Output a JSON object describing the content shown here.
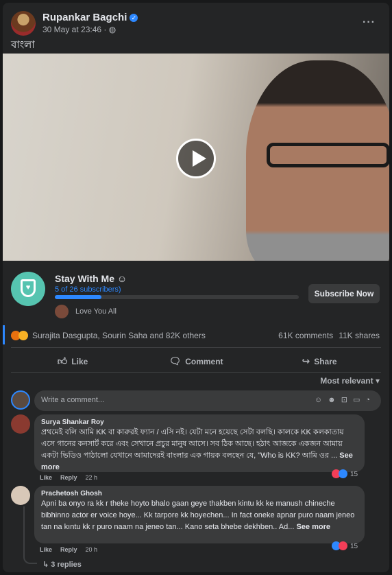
{
  "post": {
    "author": "Rupankar Bagchi",
    "timestamp": "30 May at 23:46 ·",
    "privacy_icon": "globe-icon",
    "caption": "বাংলা"
  },
  "subscription": {
    "title": "Stay With Me ☺",
    "subscribers": "5 of 26 subscribers)",
    "progress": 0.19,
    "fan_text": "Love You All",
    "button": "Subscribe Now"
  },
  "reactions": {
    "names": "Surajita Dasgupta, Sourin Saha and 82K others",
    "comments": "61K comments",
    "shares": "11K shares"
  },
  "actions": {
    "like": "Like",
    "comment": "Comment",
    "share": "Share"
  },
  "sort_label": "Most relevant ▾",
  "composer_placeholder": "Write a comment...",
  "comments": [
    {
      "name": "Surya Shankar Roy",
      "text": "প্রথমেই বলি আমি KK বা কারুরই ফ্যান / এসি নই। যেটা মনে হয়েছে সেটা বলছি। কালকে KK কলকাতায় এসে গানের কনসার্ট করে এবং সেখানে প্রচুর মানুষ আসে। সব ঠিক আছে। হঠাৎ আজকে একজন আমায় একটা ভিডিও পাঠালো যেখানে আমাদেরই বাংলার এক গায়ক বলছেন যে, \"Who is KK? আমি ওর ...",
      "see_more": "See more",
      "like": "Like",
      "reply": "Reply",
      "time": "22 h",
      "reaction_count": "15"
    },
    {
      "name": "Prachetosh Ghosh",
      "text": "Apni ba onyo ra kk r theke hoyto bhalo gaan geye thakben kintu kk ke manush chineche bibhinno actor er voice hoye... Kk tarpore kk hoyechen... In fact oneke apnar puro naam jeneo tan na kıntu kk r puro naam na jeneo tan... Kano seta bhebe dekhben.. Ad...",
      "see_more": "See more",
      "like": "Like",
      "reply": "Reply",
      "time": "20 h",
      "reaction_count": "15"
    }
  ],
  "replies_label": "3 replies",
  "colors": {
    "background": "#18191a",
    "card": "#242526",
    "accent": "#2d88ff",
    "subscribe_badge": "#56c4b0"
  }
}
